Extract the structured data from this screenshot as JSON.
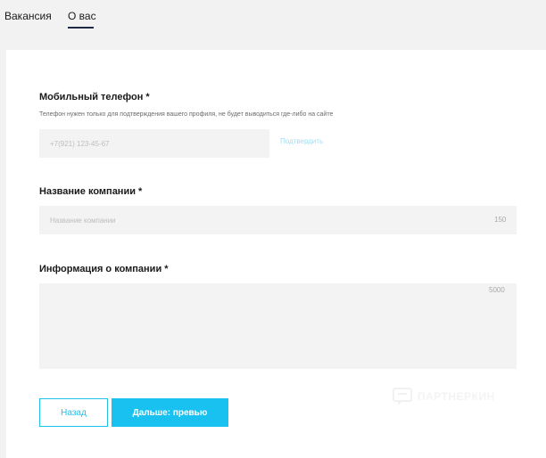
{
  "tabs": [
    {
      "label": "Вакансия"
    },
    {
      "label": "О вас",
      "active": true
    }
  ],
  "form": {
    "phone": {
      "label": "Мобильный телефон",
      "required_mark": "*",
      "hint": "Телефон нужен только для подтверждения вашего профиля, не будет выводиться где-либо на сайте",
      "placeholder": "+7(921) 123-45-67",
      "confirm_label": "Подтвердить"
    },
    "company_name": {
      "label": "Название компании",
      "required_mark": "*",
      "placeholder": "Название компании",
      "max_length": "150"
    },
    "company_info": {
      "label": "Информация о компании",
      "required_mark": "*",
      "max_length": "5000"
    }
  },
  "buttons": {
    "back_label": "Назад",
    "next_label": "Дальше: превью"
  },
  "watermark": {
    "text": "ПАРТНЕРКИН",
    "icon": "chat-bubble-logo"
  },
  "colors": {
    "accent": "#18c1f0",
    "link_light": "#9fdff2",
    "page_bg": "#f2f2f2",
    "field_bg": "#f3f3f3"
  }
}
